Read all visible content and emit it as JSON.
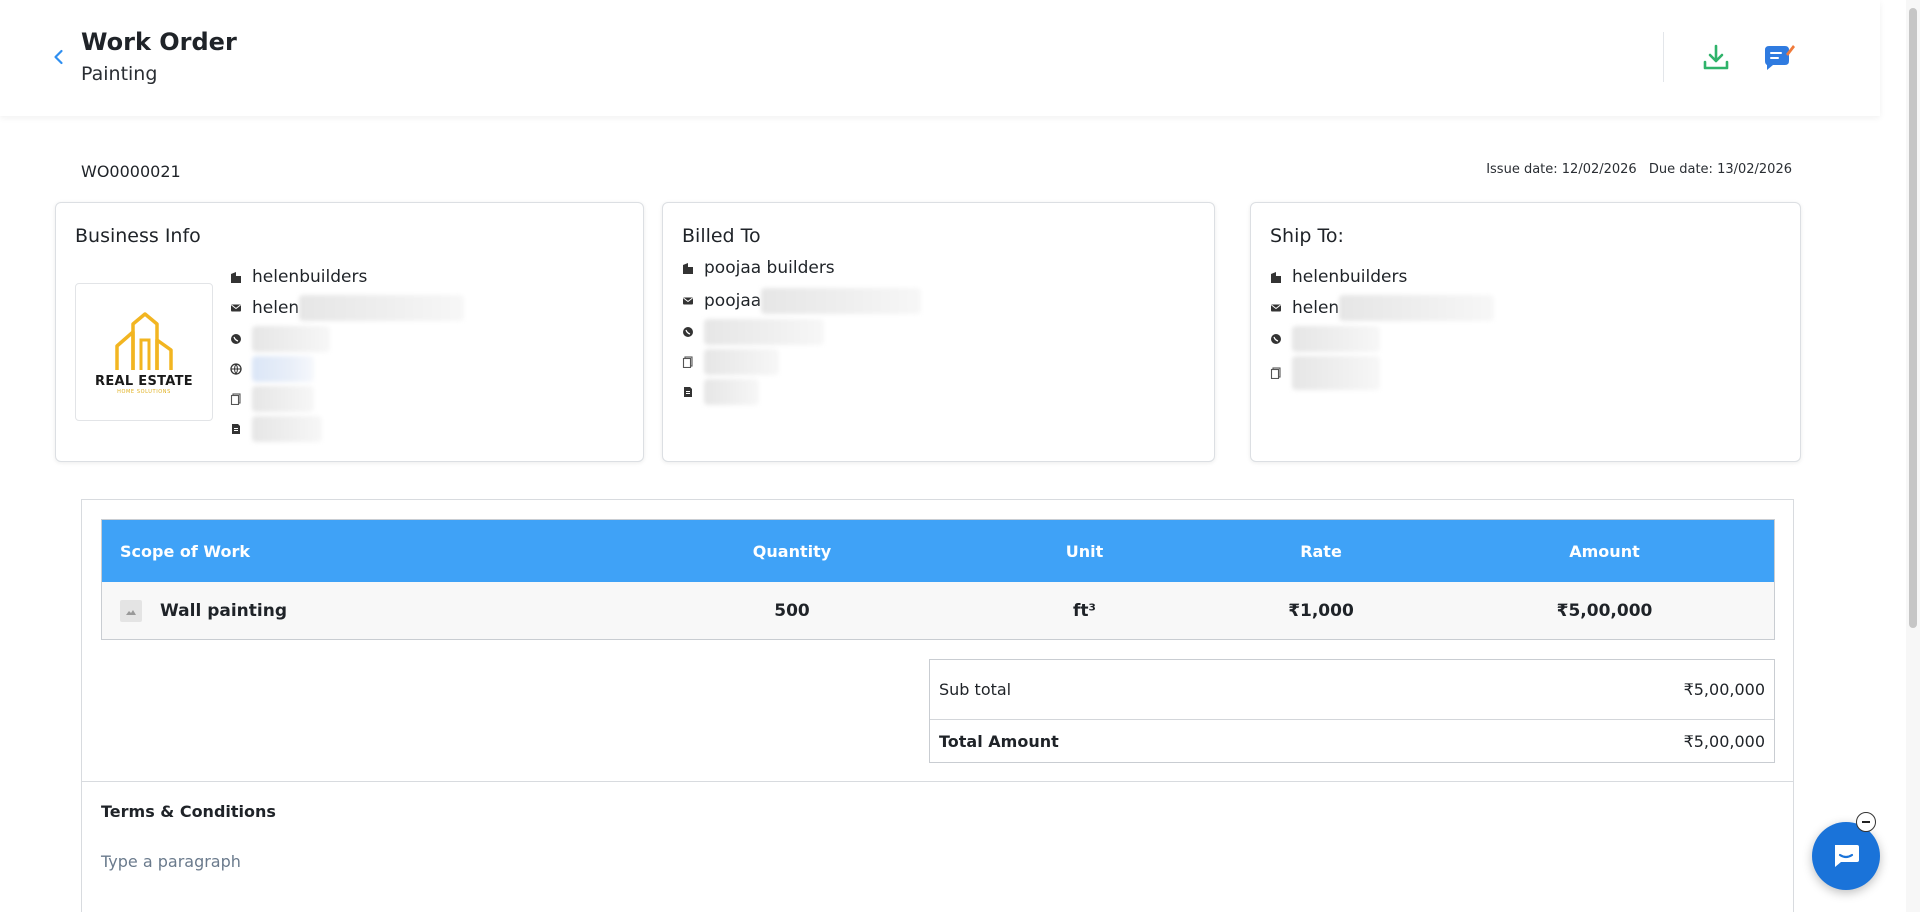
{
  "header": {
    "title": "Work Order",
    "subtitle": "Painting"
  },
  "document": {
    "number": "WO0000021",
    "issue_date": "Issue date: 12/02/2026",
    "due_date": "Due date: 13/02/2026"
  },
  "business_info": {
    "title": "Business Info",
    "name": "helenbuilders",
    "email_visible": "helen",
    "logo_text": "REAL ESTATE",
    "logo_sub": "HOME SOLUTIONS"
  },
  "billed_to": {
    "title": "Billed To",
    "name": "poojaa builders",
    "email_visible": "poojaa"
  },
  "ship_to": {
    "title": "Ship To:",
    "name": "helenbuilders",
    "email_visible": "helen"
  },
  "items_table": {
    "headers": [
      "Scope of Work",
      "Quantity",
      "Unit",
      "Rate",
      "Amount"
    ],
    "rows": [
      {
        "scope": "Wall painting",
        "quantity": "500",
        "unit": "ft³",
        "rate": "₹1,000",
        "amount": "₹5,00,000"
      }
    ]
  },
  "totals": {
    "subtotal_label": "Sub total",
    "subtotal_value": "₹5,00,000",
    "total_label": "Total Amount",
    "total_value": "₹5,00,000"
  },
  "terms": {
    "title": "Terms & Conditions",
    "placeholder": "Type a paragraph"
  },
  "colors": {
    "accent": "#3fa2f7",
    "download_icon": "#2fb36a",
    "chat": "#1a73d9"
  },
  "icons": {
    "back": "chevron-left-icon",
    "download": "download-icon",
    "chat_edit": "chat-edit-icon",
    "building": "building-icon",
    "email": "envelope-icon",
    "phone": "phone-icon",
    "web": "globe-icon",
    "copy": "document-copy-icon",
    "file": "file-icon",
    "chat_widget": "chat-icon"
  }
}
